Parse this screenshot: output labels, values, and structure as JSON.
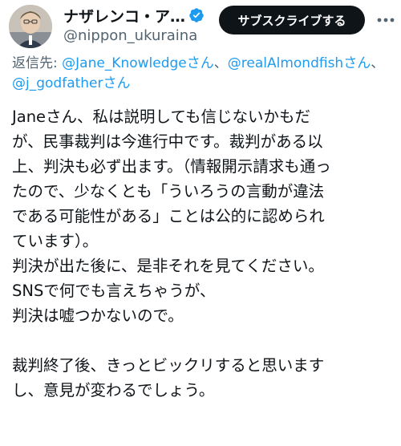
{
  "author": {
    "display_name": "ナザレンコ・ア…",
    "handle": "@nippon_ukuraina",
    "verified_icon": "verified-badge-icon",
    "avatar_icon": "profile-avatar"
  },
  "subscribe_button": {
    "label": "サブスクライブする"
  },
  "more_icon": "more-options-icon",
  "reply_to": {
    "prefix": "返信先: ",
    "mentions": [
      {
        "handle": "@Jane_Knowledge",
        "suffix": "さん"
      },
      {
        "handle": "@realAlmondfish",
        "suffix": "さん"
      },
      {
        "handle": "@j_godfather",
        "suffix": "さん"
      }
    ],
    "separator": "、"
  },
  "tweet_lines": [
    "Janeさん、私は説明しても信じないかもだ",
    "が、民事裁判は今進行中です。裁判がある以",
    "上、判決も必ず出ます。（情報開示請求も通っ",
    "たので、少なくとも「ういろうの言動が違法",
    "である可能性がある」ことは公的に認められ",
    "ています）。",
    "判決が出た後に、是非それを見てください。",
    "SNSで何でも言えちゃうが、",
    "判決は嘘つかないので。",
    "",
    "裁判終了後、きっとビックリすると思います",
    "し、意見が変わるでしょう。"
  ],
  "colors": {
    "link": "#1d9bf0",
    "secondary_text": "#536471",
    "primary_text": "#0f1419",
    "button_bg": "#0f1419"
  }
}
